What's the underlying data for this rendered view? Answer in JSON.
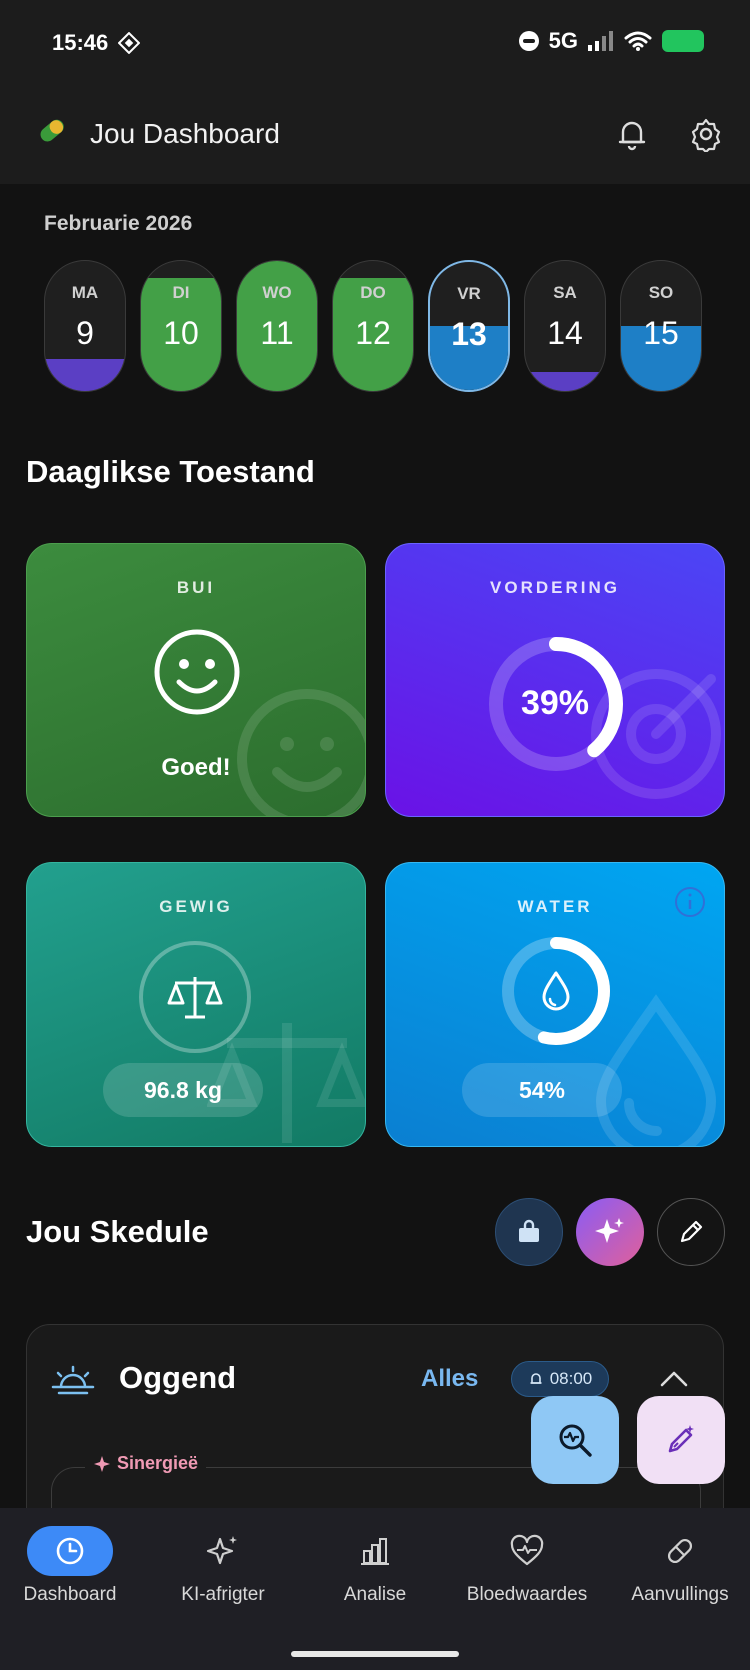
{
  "status_bar": {
    "time": "15:46",
    "network": "5G"
  },
  "header": {
    "title": "Jou Dashboard"
  },
  "calendar": {
    "month": "Februarie 2026",
    "days": [
      {
        "name": "MA",
        "date": "9",
        "fill": 0.25,
        "color": "#5b3fc4"
      },
      {
        "name": "DI",
        "date": "10",
        "fill": 0.87,
        "color": "#43a047"
      },
      {
        "name": "WO",
        "date": "11",
        "fill": 1.0,
        "color": "#43a047"
      },
      {
        "name": "DO",
        "date": "12",
        "fill": 0.87,
        "color": "#43a047"
      },
      {
        "name": "VR",
        "date": "13",
        "fill": 0.5,
        "color": "#1e7fc6"
      },
      {
        "name": "SA",
        "date": "14",
        "fill": 0.15,
        "color": "#5b3fc4"
      },
      {
        "name": "SO",
        "date": "15",
        "fill": 0.5,
        "color": "#1e7fc6"
      }
    ]
  },
  "daily_state": {
    "title": "Daaglikse Toestand",
    "mood": {
      "label": "BUI",
      "value": "Goed!"
    },
    "progress": {
      "label": "VORDERING",
      "value": "39%",
      "fraction": 0.39
    },
    "weight": {
      "label": "GEWIG",
      "value": "96.8 kg"
    },
    "water": {
      "label": "WATER",
      "value": "54%",
      "fraction": 0.54
    }
  },
  "schedule": {
    "title": "Jou Skedule",
    "morning": {
      "title": "Oggend",
      "all_label": "Alles",
      "time": "08:00",
      "synergies_label": "Sinergieë"
    }
  },
  "nav": [
    {
      "label": "Dashboard",
      "icon": "clock-icon"
    },
    {
      "label": "KI-afrigter",
      "icon": "sparkles-icon"
    },
    {
      "label": "Analise",
      "icon": "bar-chart-icon"
    },
    {
      "label": "Bloedwaardes",
      "icon": "heart-pulse-icon"
    },
    {
      "label": "Aanvullings",
      "icon": "pill-icon"
    }
  ]
}
